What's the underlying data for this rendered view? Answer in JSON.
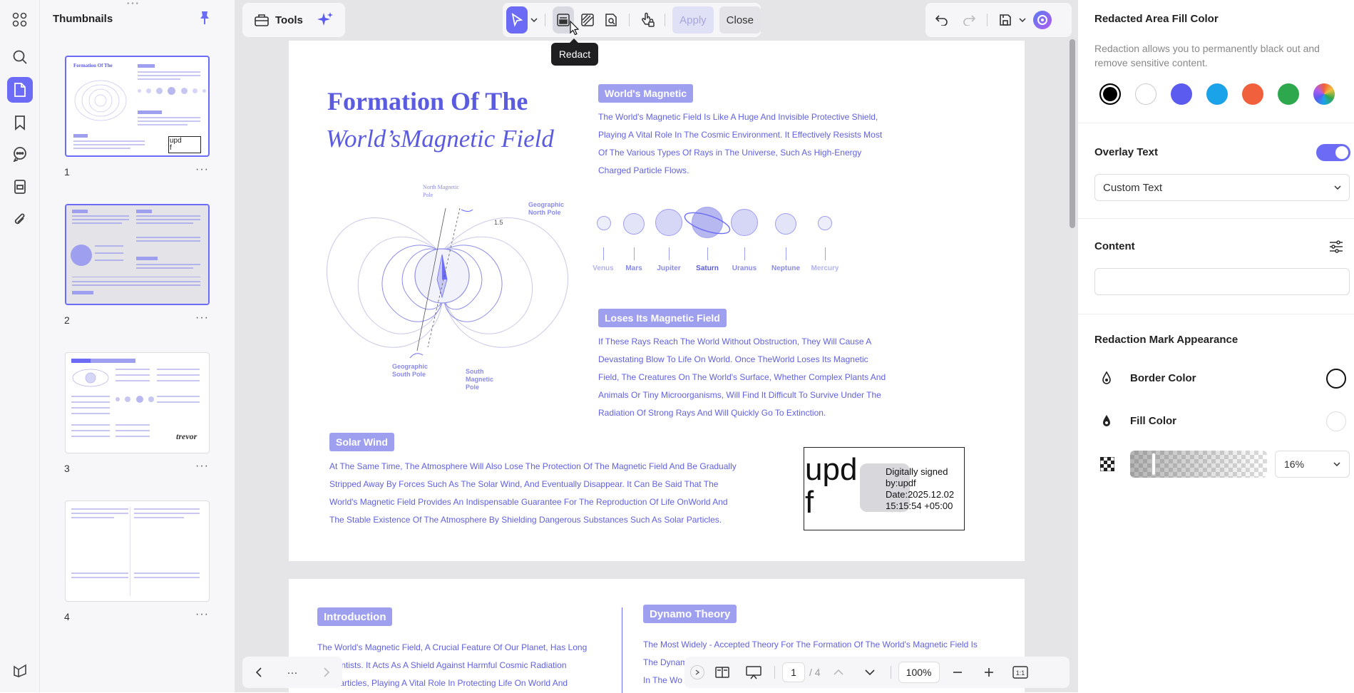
{
  "sidebar": {
    "title": "Thumbnails",
    "pages": [
      "1",
      "2",
      "3",
      "4"
    ],
    "more": "···"
  },
  "toolbar": {
    "tools_label": "Tools",
    "apply_label": "Apply",
    "close_label": "Close",
    "tooltip": "Redact"
  },
  "doc": {
    "title_line1": "Formation Of The",
    "title_line2": "World’sMagnetic Field",
    "section1_title": "World's Magnetic",
    "section1_lines": [
      "The World's Magnetic Field Is Like A Huge And Invisible Protective Shield,",
      "Playing A Vital Role In The Cosmic Environment. It Effectively Resists Most",
      "Of The Various Types Of Rays in The Universe, Such As High-Energy",
      "Charged Particle Flows."
    ],
    "planets": [
      "Venus",
      "Mars",
      "Jupiter",
      "Saturn",
      "Uranus",
      "Neptune",
      "Mercury"
    ],
    "diagram_labels": {
      "north_mag": "North Magnetic Pole",
      "geo_north": "Geographic North Pole",
      "geo_south": "Geographic South Pole",
      "south_mag": "South Magnetic Pole",
      "angle": "1.5"
    },
    "section2_title": "Loses Its Magnetic Field",
    "section2_lines": [
      "If These Rays Reach The World Without Obstruction, They Will Cause A",
      "Devastating Blow To Life On World. Once TheWorld Loses Its Magnetic",
      "Field, The Creatures On The World's Surface, Whether Complex Plants And",
      "Animals Or Tiny Microorganisms, Will Find It Difficult To Survive Under The",
      "Radiation Of Strong Rays And Will Quickly Go To Extinction."
    ],
    "section3_title": "Solar Wind",
    "section3_lines": [
      "At The Same Time, The Atmosphere Will Also Lose The Protection Of The Magnetic Field And Be Gradually",
      "Stripped Away By Forces Such As The Solar Wind, And Eventually Disappear. It Can Be Said That The",
      "World's Magnetic Field Provides An Indispensable Guarantee For The Reproduction Of Life OnWorld And",
      "The Stable Existence Of The Atmosphere By Shielding Dangerous Substances Such As Solar Particles."
    ],
    "signature": {
      "big": "upd",
      "big2": "f",
      "lines": [
        "Digitally signed",
        "by:updf",
        "Date:2025.12.02",
        "15:15:54 +05:00"
      ]
    },
    "page2": {
      "intro_title": "Introduction",
      "intro_lines": [
        "The World's Magnetic Field, A Crucial Feature Of Our Planet, Has Long",
        "d Scientists. It Acts As A Shield Against Harmful Cosmic Radiation",
        "olar Particles, Playing A Vital Role In Protecting Life On World And"
      ],
      "dynamo_title": "Dynamo Theory",
      "dynamo_lines": [
        "The Most Widely - Accepted Theory For The Formation Of The World's Magnetic Field Is",
        "The Dynam",
        "In The Wo"
      ]
    }
  },
  "bottombar": {
    "page_current": "1",
    "page_total": "/ 4",
    "zoom": "100%",
    "more": "···"
  },
  "panel": {
    "fill_title": "Redacted Area Fill Color",
    "fill_desc_1": "Redaction allows you to permanently black out and",
    "fill_desc_2": "remove sensitive content.",
    "colors": [
      "#000000",
      "#ffffff",
      "#5b5bf0",
      "#1aa3e8",
      "#f0603c",
      "#2ea84c"
    ],
    "overlay_title": "Overlay Text",
    "overlay_select": "Custom Text",
    "content_title": "Content",
    "content_value": "",
    "mark_title": "Redaction Mark Appearance",
    "border_color_label": "Border Color",
    "fill_color_label": "Fill Color",
    "opacity": "16%"
  },
  "colors": {
    "accent": "#6b6bf6",
    "doc_text": "#6161e0",
    "pill": "#9f9ff0"
  }
}
